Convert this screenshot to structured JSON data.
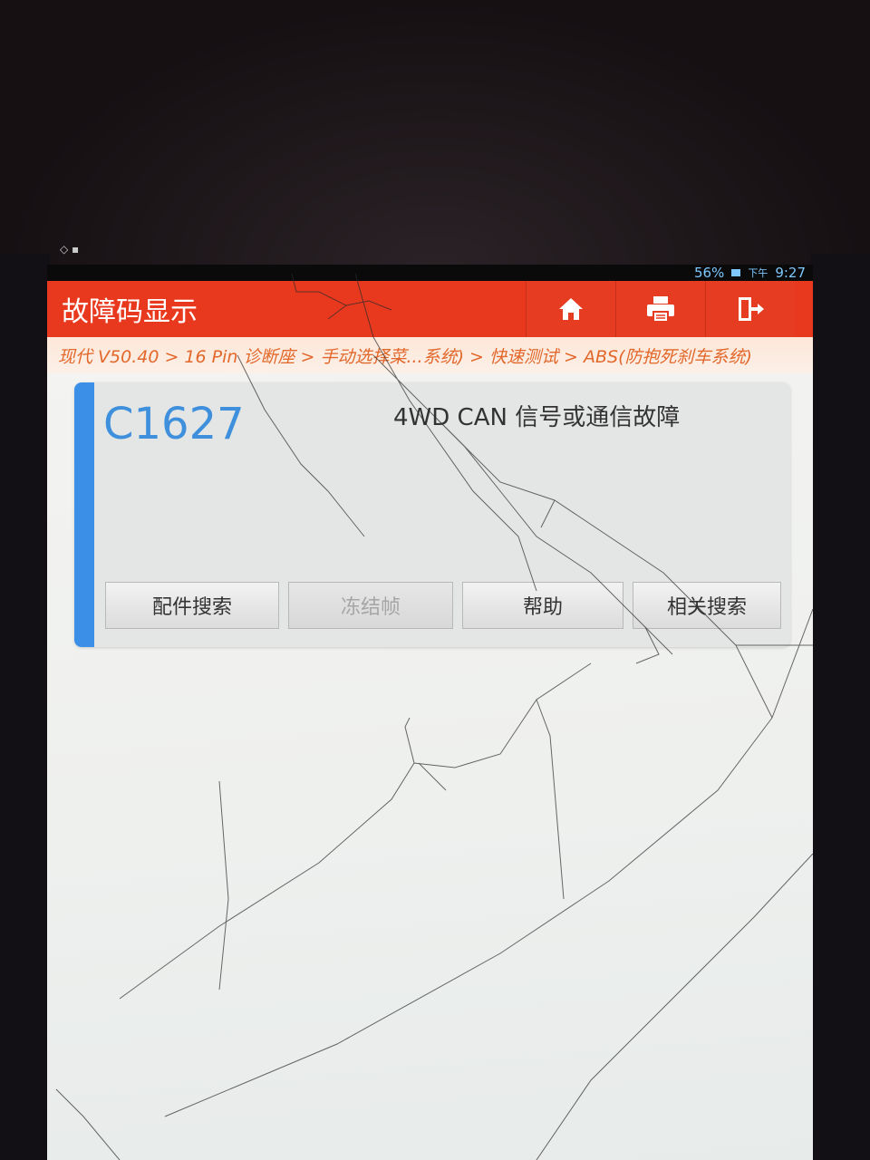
{
  "status_bar": {
    "battery": "56%",
    "time_period": "下午",
    "time": "9:27"
  },
  "header": {
    "title": "故障码显示",
    "buttons": [
      {
        "icon": "home-icon"
      },
      {
        "icon": "print-icon"
      },
      {
        "icon": "exit-icon"
      }
    ]
  },
  "breadcrumb": "现代 V50.40 > 16 Pin 诊断座 > 手动选择菜...系统) > 快速测试 > ABS(防抱死刹车系统)",
  "dtc": {
    "code": "C1627",
    "description": "4WD CAN 信号或通信故障",
    "buttons": {
      "parts_search": "配件搜索",
      "freeze_frame": "冻结帧",
      "help": "帮助",
      "related_search": "相关搜索"
    }
  },
  "colors": {
    "header": "#e8391e",
    "breadcrumb_text": "#e2672a",
    "dtc_code": "#3e8fdc",
    "accent": "#3b8fe6"
  }
}
